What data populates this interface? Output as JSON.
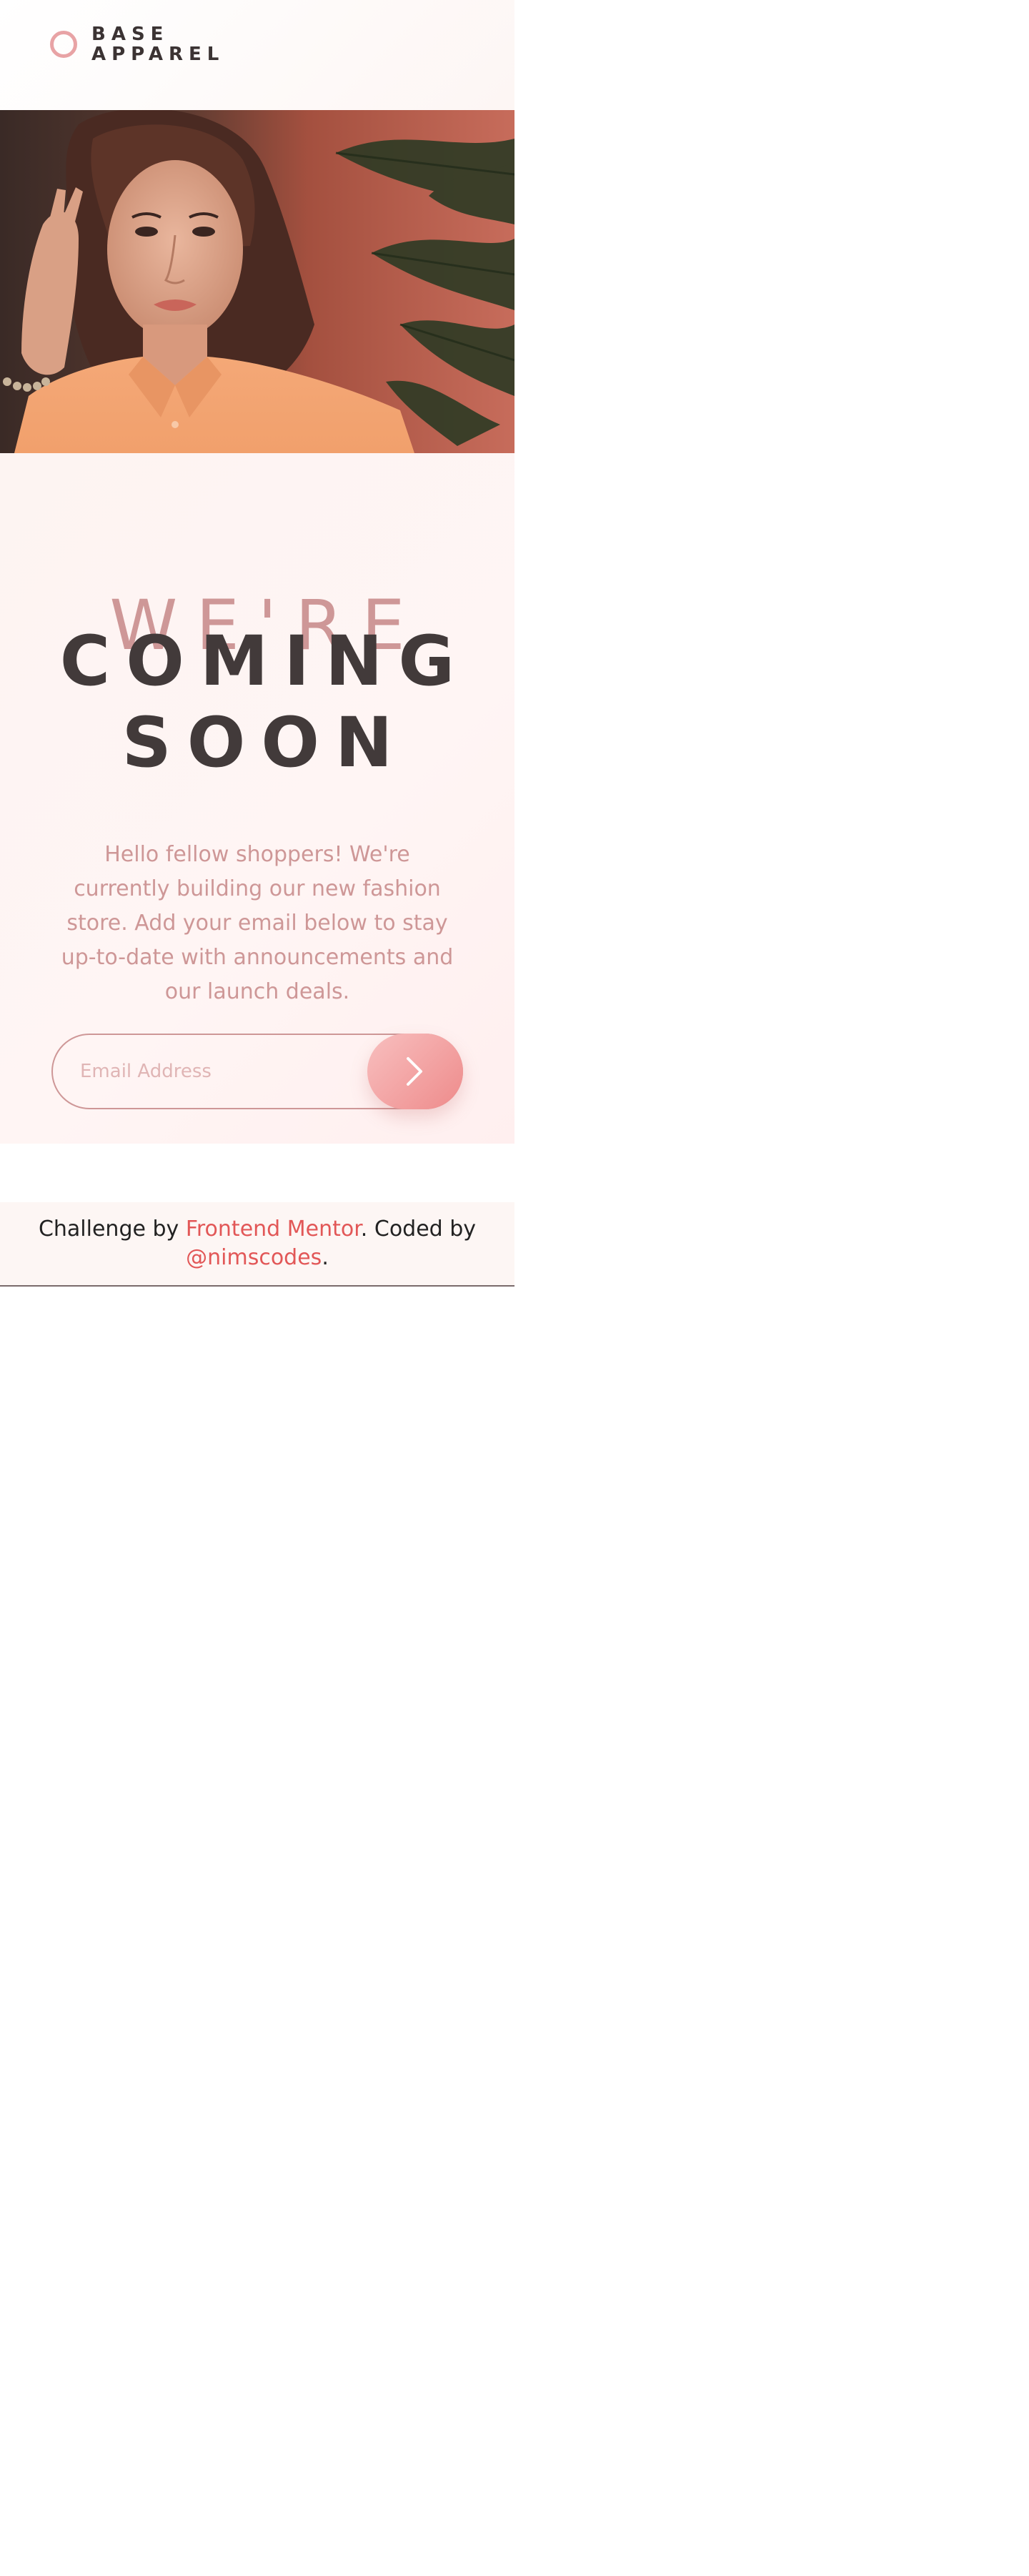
{
  "brand": {
    "line1": "BASE",
    "line2": "APPAREL"
  },
  "hero": {
    "image_icon": "woman-portrait-photo"
  },
  "heading": {
    "light": "WE'RE",
    "bold_line1": "COMING",
    "bold_line2": "SOON"
  },
  "description": "Hello fellow shoppers! We're currently building our new fashion store. Add your email below to stay up-to-date with announcements and our launch deals.",
  "form": {
    "email_placeholder": "Email Address",
    "email_value": "",
    "submit_icon": "chevron-right-icon"
  },
  "footer": {
    "prefix": "Challenge by ",
    "link1": "Frontend Mentor",
    "middle": ". Coded by ",
    "link2": "@nimscodes",
    "suffix": "."
  },
  "colors": {
    "accent": "#ce9797",
    "dark": "#423a3a",
    "link": "#e25757",
    "button_start": "#f8bfbf",
    "button_end": "#ee8b8b"
  }
}
